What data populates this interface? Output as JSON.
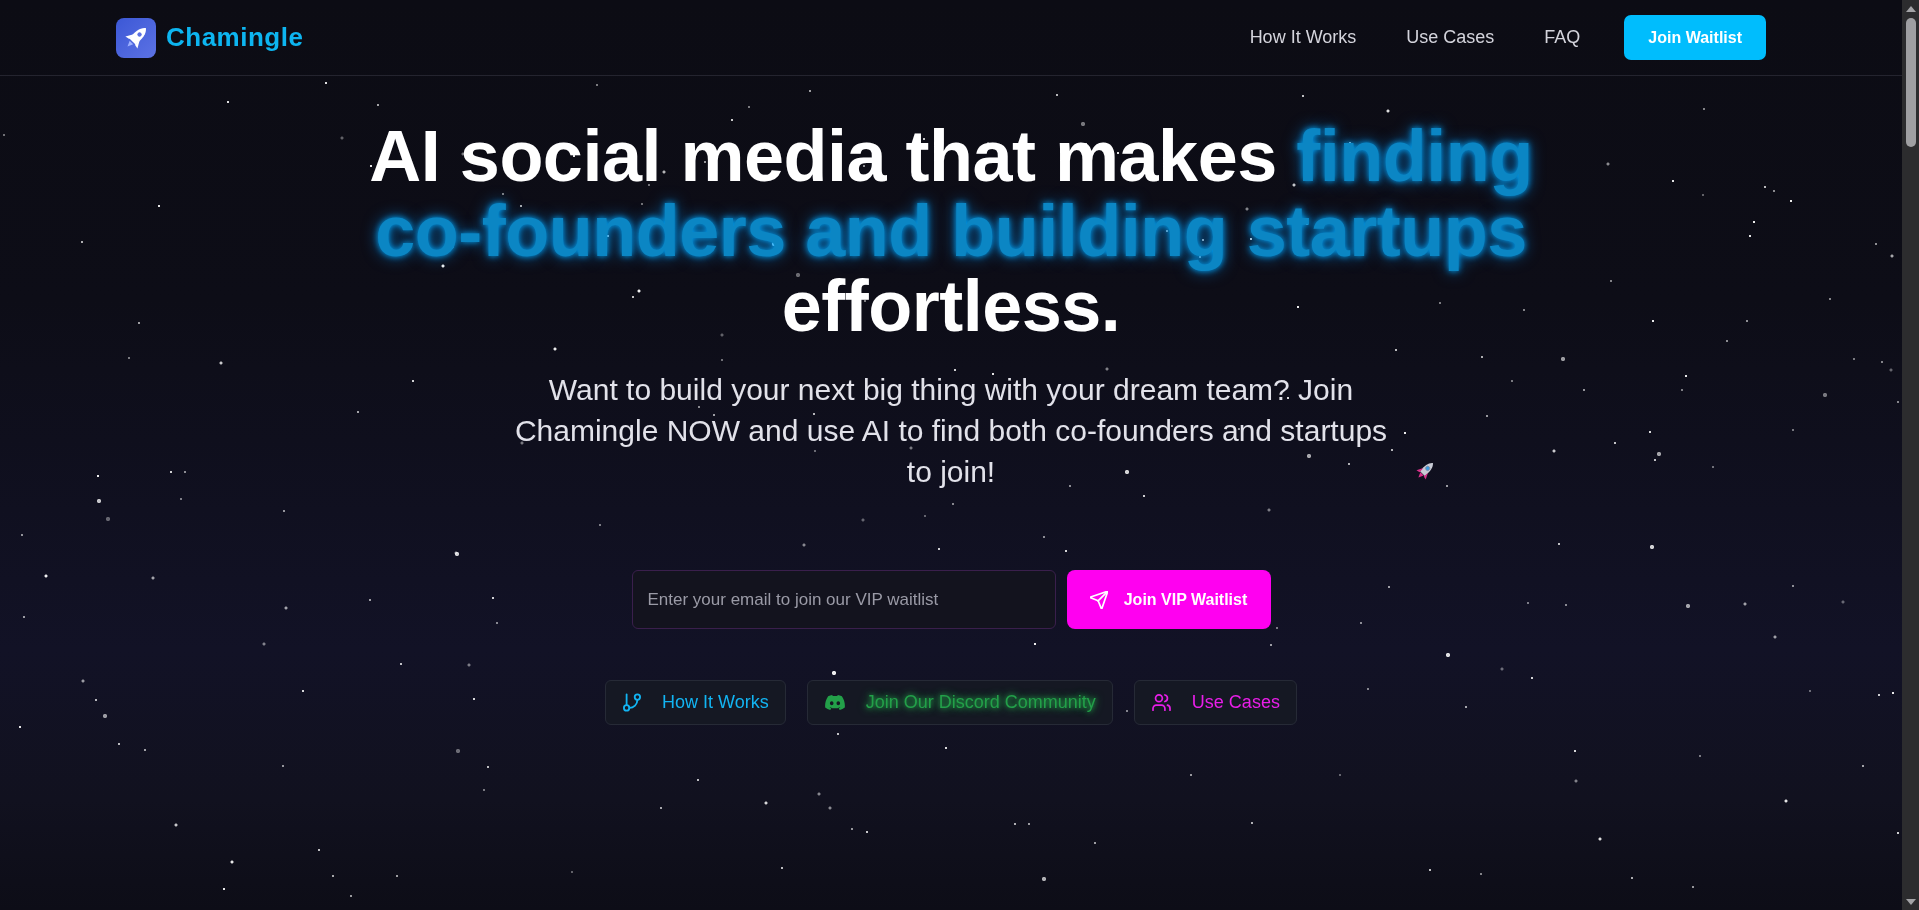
{
  "header": {
    "brand": "Chamingle",
    "nav": [
      {
        "label": "How It Works"
      },
      {
        "label": "Use Cases"
      },
      {
        "label": "FAQ"
      }
    ],
    "cta": "Join Waitlist"
  },
  "hero": {
    "headline": [
      {
        "text": "AI social media that makes ",
        "highlight": false
      },
      {
        "text": "finding co-founders and building startups",
        "highlight": true
      },
      {
        "text": " effortless.",
        "highlight": false
      }
    ],
    "subtitle": "Want to build your next big thing with your dream team? Join Chamingle NOW and use AI to find both co-founders and startups to join!",
    "signup": {
      "placeholder": "Enter your email to join our VIP waitlist",
      "button": "Join VIP Waitlist"
    },
    "links": [
      {
        "label": "How It Works",
        "kind": "branch",
        "color": "#12b4f2",
        "glow": false
      },
      {
        "label": "Join Our Discord Community",
        "kind": "discord",
        "color": "#23a049",
        "glow": true
      },
      {
        "label": "Use Cases",
        "kind": "users",
        "color": "#e81ee8",
        "glow": false
      }
    ]
  }
}
